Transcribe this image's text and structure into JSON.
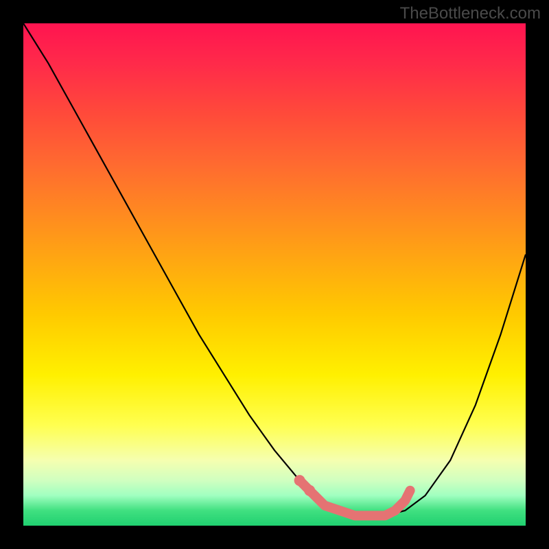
{
  "watermark": "TheBottleneck.com",
  "chart_data": {
    "type": "line",
    "title": "",
    "xlabel": "",
    "ylabel": "",
    "xlim": [
      0,
      100
    ],
    "ylim": [
      0,
      100
    ],
    "grid": false,
    "background": "red-yellow-green vertical gradient",
    "series": [
      {
        "name": "bottleneck-curve",
        "color": "#000000",
        "x": [
          0,
          5,
          10,
          15,
          20,
          25,
          30,
          35,
          40,
          45,
          50,
          55,
          58,
          60,
          63,
          65,
          68,
          72,
          76,
          80,
          85,
          90,
          95,
          100
        ],
        "y": [
          100,
          92,
          83,
          74,
          65,
          56,
          47,
          38,
          30,
          22,
          15,
          9,
          6,
          4,
          3,
          2,
          2,
          2,
          3,
          6,
          13,
          24,
          38,
          54
        ]
      }
    ],
    "markers": {
      "name": "highlighted-region",
      "color": "#e57373",
      "points_x": [
        55,
        57,
        58,
        60,
        63,
        66,
        69,
        72,
        74,
        75,
        76,
        77
      ],
      "points_y": [
        9,
        7,
        6,
        4,
        3,
        2,
        2,
        2,
        3,
        4,
        5,
        7
      ]
    }
  }
}
